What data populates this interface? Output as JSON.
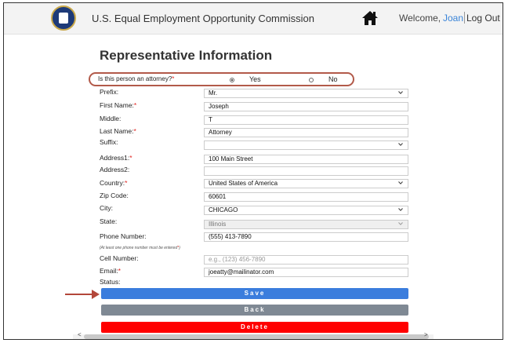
{
  "header": {
    "agency": "U.S. Equal Employment Opportunity Commission",
    "welcome": "Welcome,",
    "user": "Joan",
    "logout": "Log Out",
    "home_icon": "home-icon",
    "seal_icon": "agency-seal-icon"
  },
  "page": {
    "title": "Representative Information"
  },
  "attorney": {
    "question": "Is this person an attorney?",
    "required": "*",
    "yes": "Yes",
    "no": "No",
    "selected": "Yes"
  },
  "labels": {
    "prefix": "Prefix:",
    "first": "First Name:",
    "middle": "Middle:",
    "last": "Last Name:",
    "suffix": "Suffix:",
    "address1": "Address1:",
    "address2": "Address2:",
    "country": "Country:",
    "zip": "Zip Code:",
    "city": "City:",
    "state": "State:",
    "phone": "Phone Number:",
    "phone_hint": "(At least one phone number must be entered",
    "hint_star": "*",
    "hint_close": ")",
    "cell": "Cell Number:",
    "email": "Email:",
    "status": "Status:",
    "req": "*"
  },
  "values": {
    "prefix": "Mr.",
    "first": "Joseph",
    "middle": "T",
    "last": "Attorney",
    "suffix": "",
    "address1": "100 Main Street",
    "address2": "",
    "country": "United States of America",
    "zip": "60601",
    "city": "CHICAGO",
    "state": "Illinois",
    "phone": "(555) 413-7890",
    "cell_placeholder": "e.g., (123) 456-7890",
    "email": "joeatty@mailinator.com"
  },
  "buttons": {
    "save": "Save",
    "back": "Back",
    "delete": "Delete"
  },
  "scroll": {
    "left": "<",
    "right": ">"
  },
  "colors": {
    "accent": "#3b7ddd",
    "danger": "#ff0000",
    "neutral": "#7f8994",
    "required": "#e0201c",
    "link": "#3a84d8"
  }
}
